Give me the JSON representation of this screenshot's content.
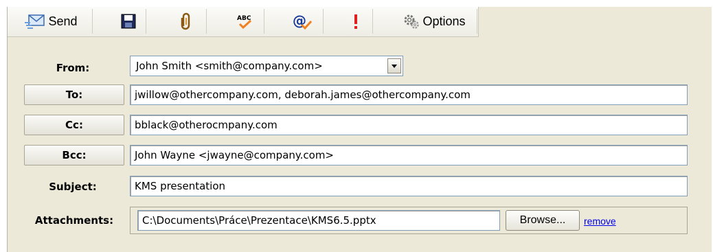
{
  "toolbar": {
    "send_label": "Send",
    "options_label": "Options",
    "icons": [
      "send-envelope-icon",
      "save-disk-icon",
      "attach-paperclip-icon",
      "spellcheck-abc-icon",
      "check-address-icon",
      "priority-exclamation-icon",
      "options-gears-icon"
    ]
  },
  "form": {
    "from_label": "From:",
    "from_value": "John Smith <smith@company.com>",
    "to_label": "To:",
    "to_value": "jwillow@othercompany.com, deborah.james@othercompany.com",
    "cc_label": "Cc:",
    "cc_value": "bblack@otherocmpany.com",
    "bcc_label": "Bcc:",
    "bcc_value": "John Wayne <jwayne@company.com>",
    "subject_label": "Subject:",
    "subject_value": "KMS presentation",
    "attachments_label": "Attachments:",
    "attachment_path": "C:\\Documents\\Práce\\Prezentace\\KMS6.5.pptx",
    "browse_label": "Browse...",
    "remove_label": "remove"
  },
  "colors": {
    "panel_bg": "#ece9d8",
    "field_border": "#7f9db9",
    "link": "#0000ee",
    "priority_red": "#e02020",
    "at_blue": "#1a3a9a",
    "check_orange": "#f08020"
  }
}
